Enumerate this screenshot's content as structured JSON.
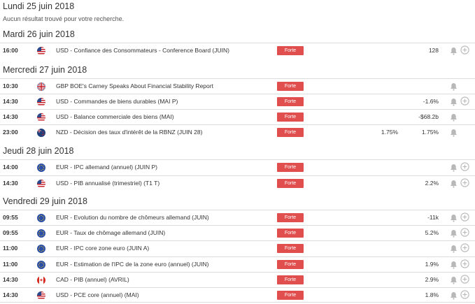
{
  "days": [
    {
      "heading": "Lundi 25 juin 2018",
      "note": "Aucun résultat trouvé pour votre recherche.",
      "events": []
    },
    {
      "heading": "Mardi 26 juin 2018",
      "events": [
        {
          "time": "16:00",
          "flag": "us",
          "name": "USD - Confiance des Consommateurs - Conference Board (JUIN)",
          "impact": "Forte",
          "forecast": "",
          "previous": "128",
          "add": true
        }
      ]
    },
    {
      "heading": "Mercredi 27 juin 2018",
      "events": [
        {
          "time": "10:30",
          "flag": "gb",
          "name": "GBP BOE's Carney Speaks About Financial Stability Report",
          "impact": "Forte",
          "forecast": "",
          "previous": "",
          "add": false
        },
        {
          "time": "14:30",
          "flag": "us",
          "name": "USD - Commandes de biens durables (MAI P)",
          "impact": "Forte",
          "forecast": "",
          "previous": "-1.6%",
          "add": true
        },
        {
          "time": "14:30",
          "flag": "us",
          "name": "USD - Balance commerciale des biens (MAI)",
          "impact": "Forte",
          "forecast": "",
          "previous": "-$68.2b",
          "add": false
        },
        {
          "time": "23:00",
          "flag": "nz",
          "name": "NZD - Décision des taux d'intérêt de la RBNZ (JUIN 28)",
          "impact": "Forte",
          "forecast": "1.75%",
          "previous": "1.75%",
          "add": false
        }
      ]
    },
    {
      "heading": "Jeudi 28 juin 2018",
      "events": [
        {
          "time": "14:00",
          "flag": "eu",
          "name": "EUR - IPC allemand (annuel) (JUIN P)",
          "impact": "Forte",
          "forecast": "",
          "previous": "",
          "add": true
        },
        {
          "time": "14:30",
          "flag": "us",
          "name": "USD - PIB annualisé (trimestriel) (T1 T)",
          "impact": "Forte",
          "forecast": "",
          "previous": "2.2%",
          "add": true
        }
      ]
    },
    {
      "heading": "Vendredi 29 juin 2018",
      "events": [
        {
          "time": "09:55",
          "flag": "eu",
          "name": "EUR - Evolution du nombre de chômeurs allemand (JUIN)",
          "impact": "Forte",
          "forecast": "",
          "previous": "-11k",
          "add": true
        },
        {
          "time": "09:55",
          "flag": "eu",
          "name": "EUR - Taux de chômage allemand (JUIN)",
          "impact": "Forte",
          "forecast": "",
          "previous": "5.2%",
          "add": true
        },
        {
          "time": "11:00",
          "flag": "eu",
          "name": "EUR - IPC core zone euro (JUIN A)",
          "impact": "Forte",
          "forecast": "",
          "previous": "",
          "add": true
        },
        {
          "time": "11:00",
          "flag": "eu",
          "name": "EUR - Estimation de l'IPC de la zone euro (annuel) (JUIN)",
          "impact": "Forte",
          "forecast": "",
          "previous": "1.9%",
          "add": true
        },
        {
          "time": "14:30",
          "flag": "ca",
          "name": "CAD - PIB (annuel) (AVRIL)",
          "impact": "Forte",
          "forecast": "",
          "previous": "2.9%",
          "add": true
        },
        {
          "time": "14:30",
          "flag": "us",
          "name": "USD - PCE core (annuel) (MAI)",
          "impact": "Forte",
          "forecast": "",
          "previous": "1.8%",
          "add": true
        }
      ]
    }
  ],
  "icons": {
    "alert": "bell-icon",
    "add": "plus-circle-icon"
  },
  "colors": {
    "impact_badge": "#e04e4e",
    "divider": "#dcdcdc",
    "icon_gray": "#b8b8b8"
  }
}
